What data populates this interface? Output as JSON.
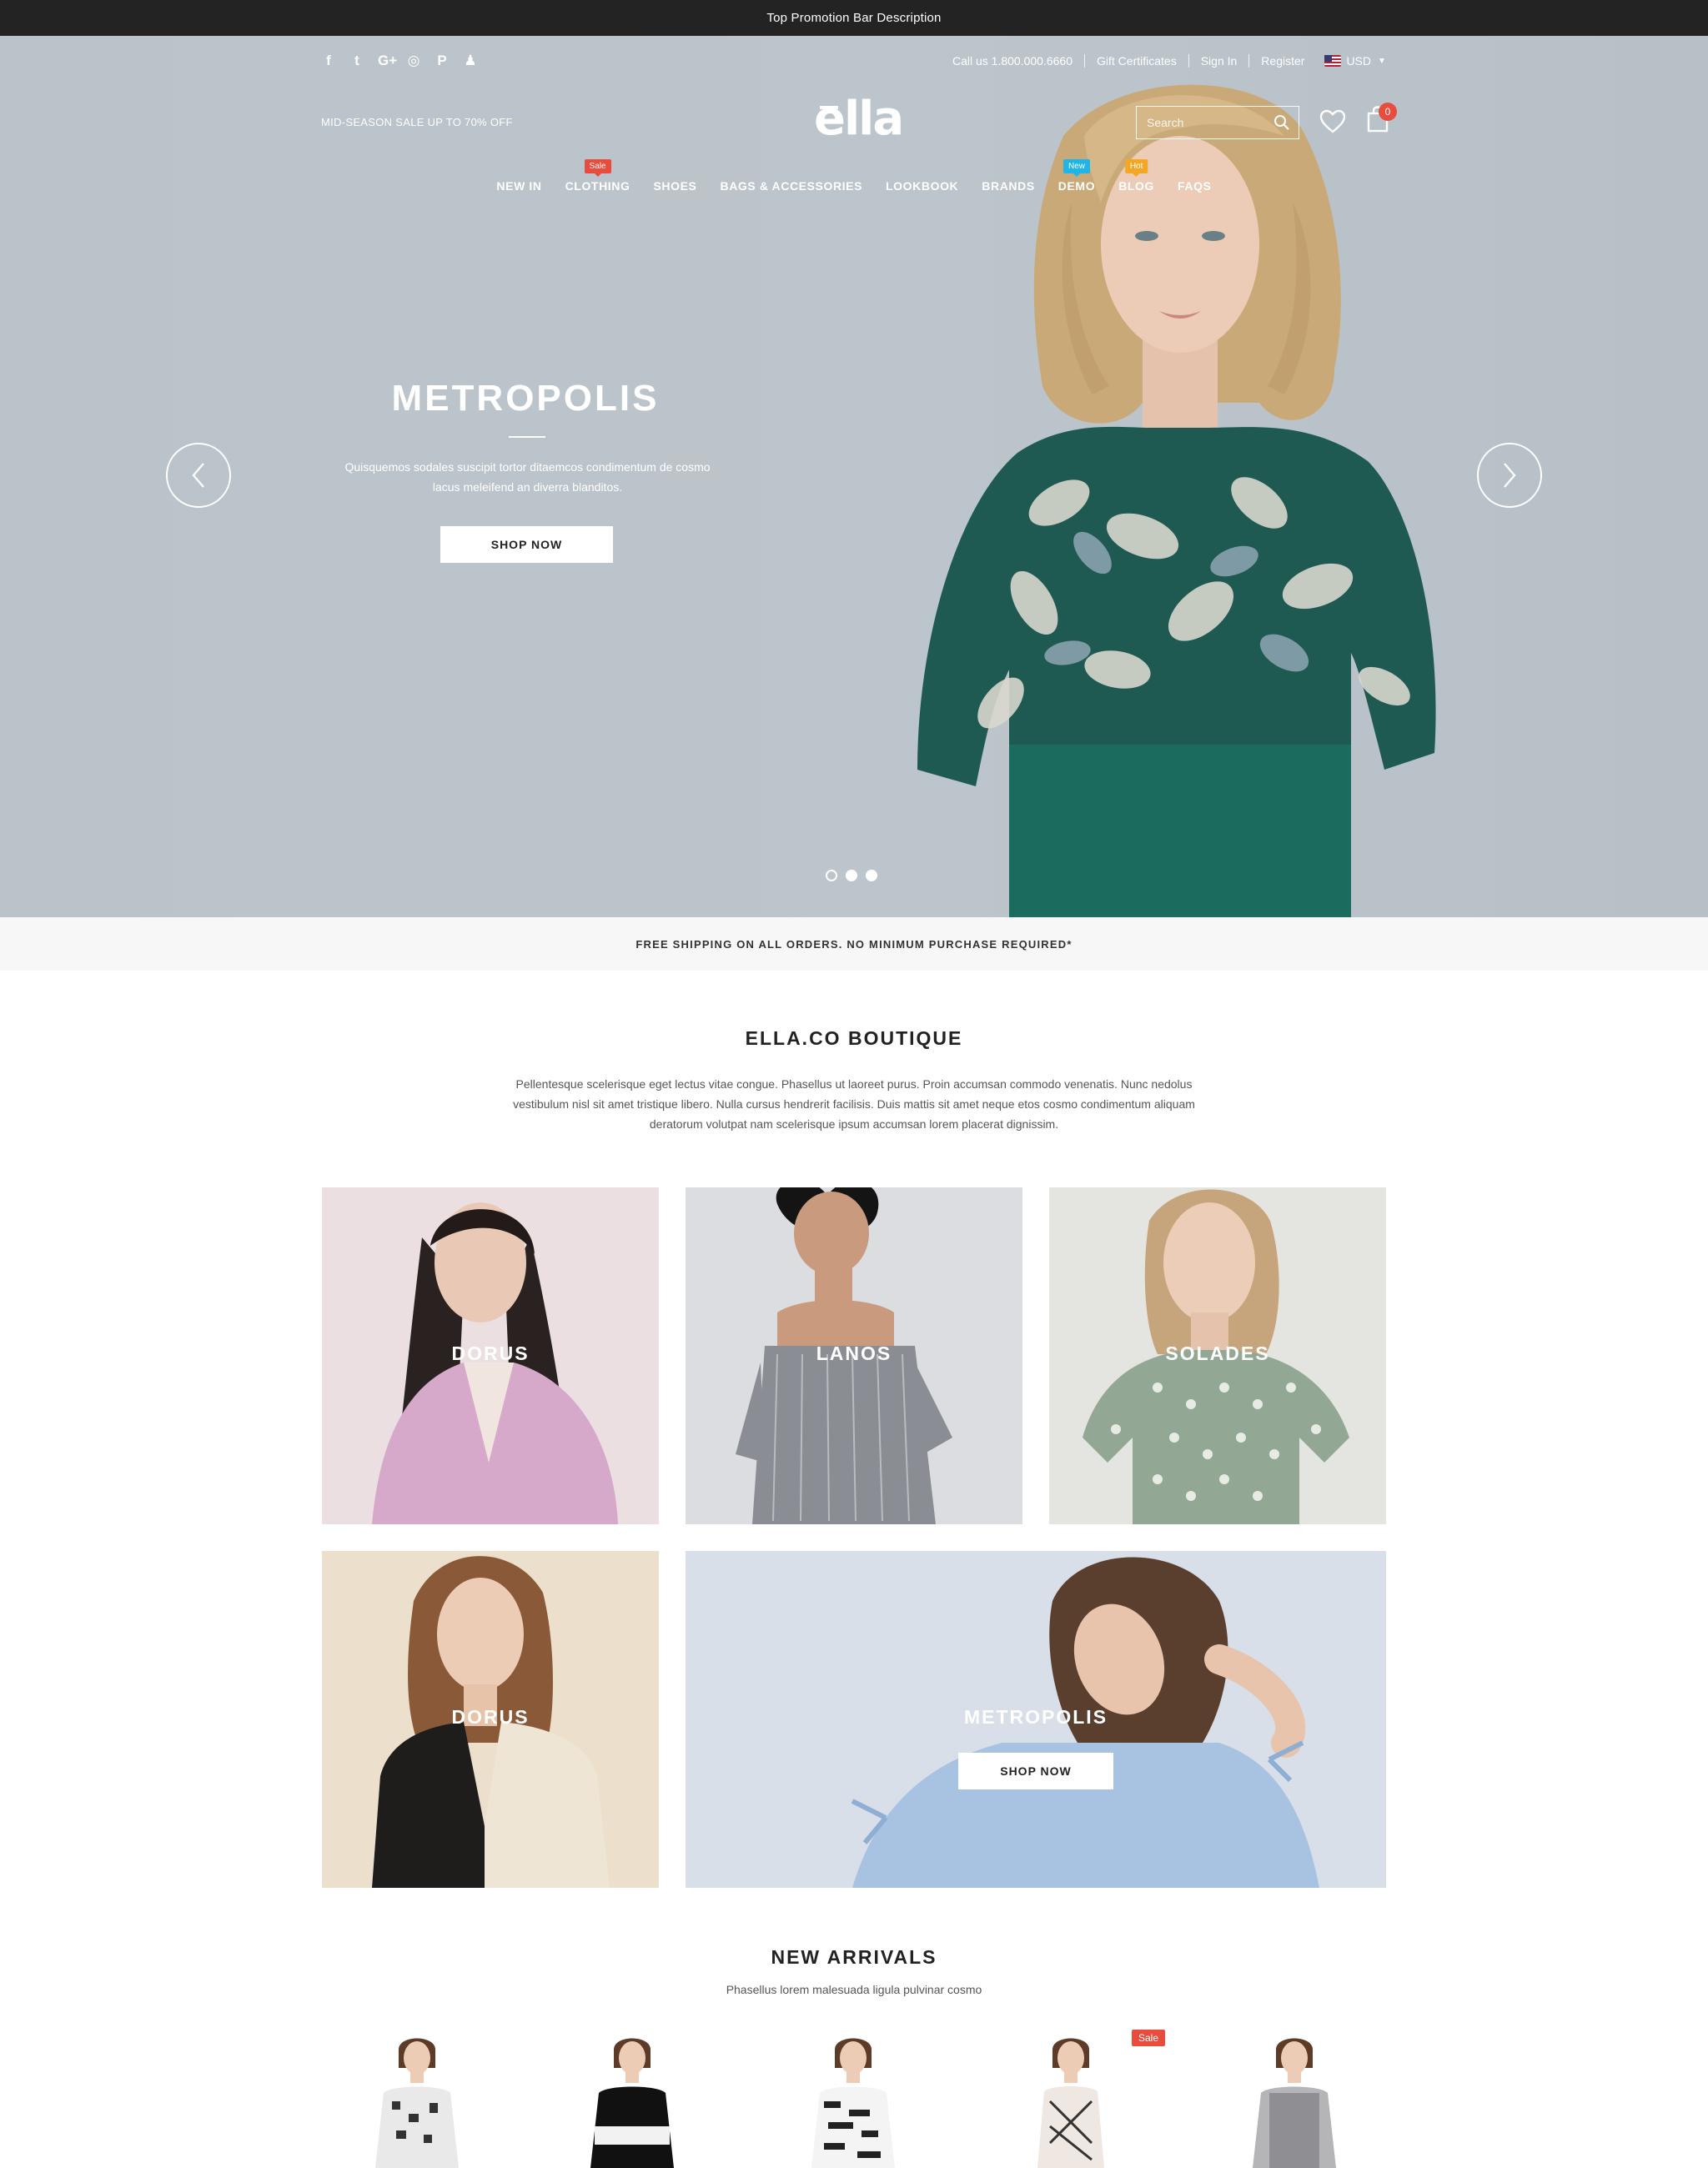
{
  "promo_bar": {
    "text": "Top Promotion Bar Description"
  },
  "header": {
    "social_icons": [
      "facebook-icon",
      "twitter-icon",
      "google-plus-icon",
      "instagram-icon",
      "pinterest-icon",
      "snapchat-icon"
    ],
    "links": {
      "call": "Call us 1.800.000.6660",
      "gift": "Gift Certificates",
      "signin": "Sign In",
      "register": "Register",
      "currency": "USD"
    },
    "sale_note": "MID-SEASON SALE UP TO 70% OFF",
    "logo": "ella",
    "search_placeholder": "Search",
    "cart_count": "0",
    "nav": [
      {
        "label": "NEW IN",
        "badge": ""
      },
      {
        "label": "CLOTHING",
        "badge": "Sale",
        "badge_color": "#e74c3c"
      },
      {
        "label": "SHOES",
        "badge": ""
      },
      {
        "label": "BAGS & ACCESSORIES",
        "badge": ""
      },
      {
        "label": "LOOKBOOK",
        "badge": ""
      },
      {
        "label": "BRANDS",
        "badge": ""
      },
      {
        "label": "DEMO",
        "badge": "New",
        "badge_color": "#1fb5e8"
      },
      {
        "label": "BLOG",
        "badge": "Hot",
        "badge_color": "#f5a623"
      },
      {
        "label": "FAQS",
        "badge": ""
      }
    ]
  },
  "hero": {
    "title": "METROPOLIS",
    "subtitle": "Quisquemos sodales suscipit tortor ditaemcos condimentum de cosmo lacus meleifend an diverra blanditos.",
    "button": "SHOP NOW",
    "slides": 3,
    "active_slide": 2
  },
  "shipping": {
    "text": "FREE SHIPPING ON ALL ORDERS. NO MINIMUM PURCHASE REQUIRED*"
  },
  "boutique": {
    "title": "ELLA.CO BOUTIQUE",
    "description": "Pellentesque scelerisque eget lectus vitae congue. Phasellus ut laoreet purus. Proin accumsan commodo venenatis. Nunc nedolus vestibulum nisl sit amet tristique libero. Nulla cursus hendrerit facilisis. Duis mattis sit amet neque etos cosmo condimentum aliquam deratorum volutpat nam scelerisque ipsum accumsan lorem placerat dignissim.",
    "tiles": [
      {
        "label": "DORUS"
      },
      {
        "label": "LANOS"
      },
      {
        "label": "SOLADES"
      },
      {
        "label": "DORUS"
      },
      {
        "label": "METROPOLIS",
        "button": "SHOP NOW"
      }
    ]
  },
  "arrivals": {
    "title": "NEW ARRIVALS",
    "subtitle": "Phasellus lorem malesuada ligula pulvinar cosmo",
    "sale_tag": "Sale"
  }
}
